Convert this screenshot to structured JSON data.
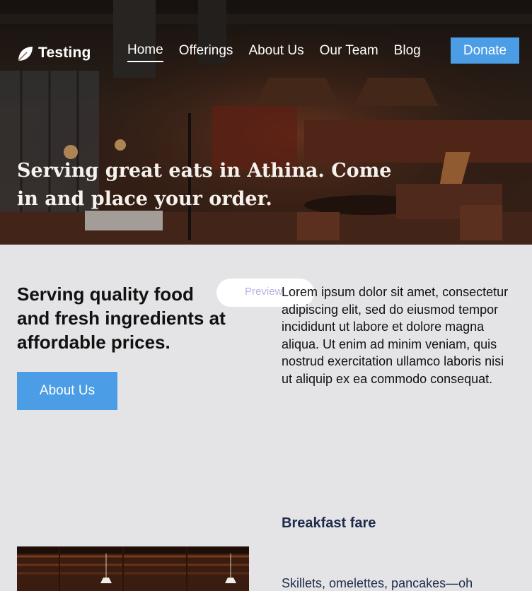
{
  "brand": {
    "name": "Testing",
    "logo_icon": "leaf-logo-icon"
  },
  "nav": {
    "items": [
      {
        "label": "Home",
        "active": true
      },
      {
        "label": "Offerings",
        "active": false
      },
      {
        "label": "About Us",
        "active": false
      },
      {
        "label": "Our Team",
        "active": false
      },
      {
        "label": "Blog",
        "active": false
      }
    ],
    "cta_label": "Donate"
  },
  "hero": {
    "title": "Serving great eats in Athina. Come in and place your order."
  },
  "intro": {
    "heading": "Serving quality food and fresh ingredients at affordable prices.",
    "button_label": "About Us",
    "preview_label": "Preview",
    "body": "Lorem ipsum dolor sit amet, consectetur adipiscing elit, sed do eiusmod tempor incididunt ut labore et dolore magna aliqua. Ut enim ad minim veniam, quis nostrud exercitation ullamco laboris nisi ut aliquip ex ea commodo consequat."
  },
  "breakfast": {
    "title": "Breakfast fare",
    "description": "Skillets, omelettes, pancakes—oh"
  },
  "colors": {
    "accent": "#4b9de6",
    "page_bg": "#e4e4e6",
    "heading_blue": "#1d2b4a"
  }
}
